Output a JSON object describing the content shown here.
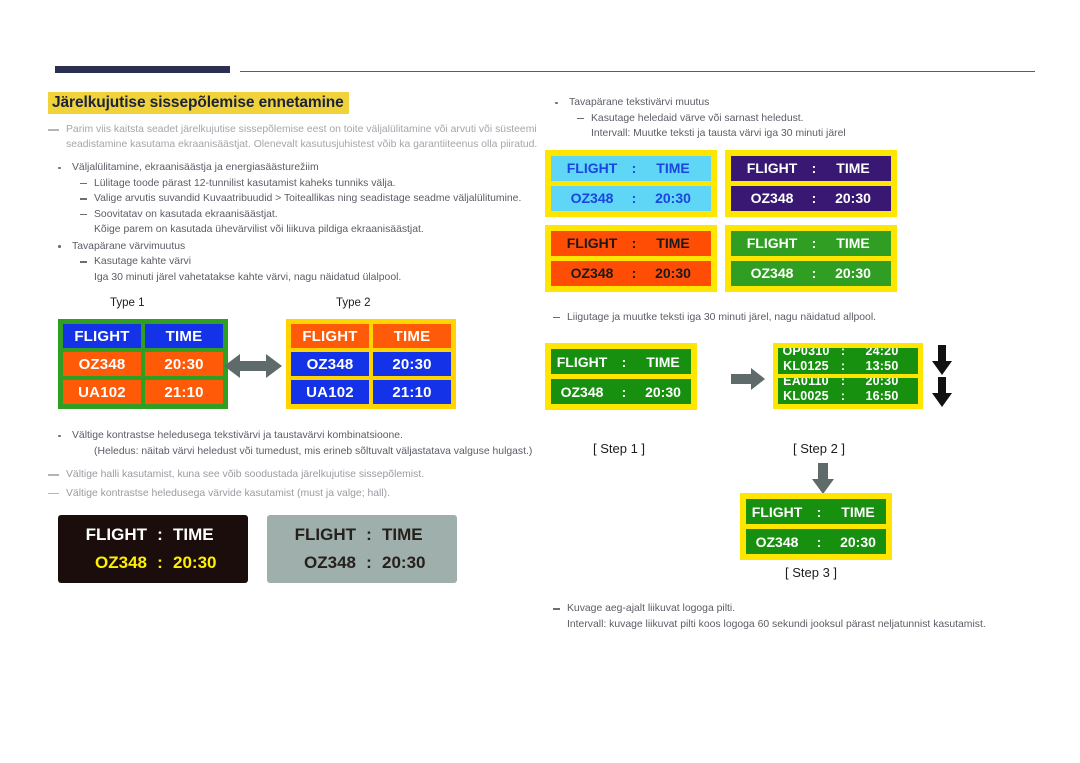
{
  "header": {
    "bar_color": "#2b3050",
    "rule_color": "#5b5b70"
  },
  "left": {
    "title": "Järelkujutise sissepõlemise ennetamine",
    "title_highlight": "#f0d33a",
    "note_intro": "Parim viis kaitsta seadet järelkujutise sissepõlemise eest on toite väljalülitamine või arvuti või süsteemi seadistamine kasutama ekraanisäästjat. Olenevalt kasutusjuhistest võib ka garantiiteenus olla piiratud.",
    "bullet1": "Väljalülitamine, ekraanisäästja ja energiasäästurežiim",
    "bullet1_sub": [
      "Lülitage toode pärast 12-tunnilist kasutamist kaheks tunniks välja.",
      "Valige arvutis suvandid Kuvaatribuudid > Toiteallikas ning seadistage seadme väljalülitumine.",
      "Soovitatav on kasutada ekraanisäästjat."
    ],
    "bullet1_note": "Kõige parem on kasutada ühevärvilist või liikuva pildiga ekraanisäästjat.",
    "bullet2": "Tavapärane värvimuutus",
    "bullet2_sub": "Kasutage kahte värvi",
    "bullet2_note": "Iga 30 minuti järel vahetatakse kahte värvi, nagu näidatud ülalpool.",
    "type1_label": "Type 1",
    "type2_label": "Type 2",
    "board_type1": {
      "border_color": "#2f9e23",
      "header_bg": "#1433e8",
      "data_bg": "#ff5a08",
      "rows": [
        [
          "FLIGHT",
          "TIME"
        ],
        [
          "OZ348",
          "20:30"
        ],
        [
          "UA102",
          "21:10"
        ]
      ]
    },
    "board_type2": {
      "border_color": "#ffd400",
      "header_bg": "#ff5a08",
      "data_bg": "#1433e8",
      "rows": [
        [
          "FLIGHT",
          "TIME"
        ],
        [
          "OZ348",
          "20:30"
        ],
        [
          "UA102",
          "21:10"
        ]
      ]
    },
    "bullet3": "Vältige kontrastse heledusega tekstivärvi ja taustavärvi kombinatsioone.",
    "bullet3_note": "(Heledus: näitab värvi heledust või tumedust, mis erineb sõltuvalt väljastatava valguse hulgast.)",
    "note2": "Vältige halli kasutamist, kuna see võib soodustada järelkujutise sissepõlemist.",
    "note3": "Vältige kontrastse heledusega värvide kasutamist (must ja valge; hall).",
    "sample_dark": {
      "bg": "#1a0d0b",
      "line1": [
        "FLIGHT",
        ":",
        "TIME"
      ],
      "line2": [
        "OZ348",
        ":",
        "20:30"
      ],
      "line1_color": "#ffffff",
      "line2_color": "#ffef00"
    },
    "sample_gray": {
      "bg": "#9fb0ac",
      "line1": [
        "FLIGHT",
        ":",
        "TIME"
      ],
      "line2": [
        "OZ348",
        ":",
        "20:30"
      ],
      "text_color": "#26201c"
    }
  },
  "right": {
    "bullet1": "Tavapärane tekstivärvi muutus",
    "bullet1_sub": "Kasutage heledaid värve või sarnast heledust.",
    "bullet1_note": "Intervall: Muutke teksti ja tausta värvi iga 30 minuti järel",
    "panels": [
      {
        "name": "cyan",
        "frame": "#ffe600",
        "bg": "#5fd6f5",
        "fg": "#1a45e0",
        "line1": [
          "FLIGHT",
          ":",
          "TIME"
        ],
        "line2": [
          "OZ348",
          ":",
          "20:30"
        ]
      },
      {
        "name": "purple",
        "frame": "#ffe600",
        "bg": "#381872",
        "fg": "#ffffff",
        "line1": [
          "FLIGHT",
          ":",
          "TIME"
        ],
        "line2": [
          "OZ348",
          ":",
          "20:30"
        ]
      },
      {
        "name": "orange",
        "frame": "#ffe600",
        "bg": "#ff4d06",
        "fg": "#1a1a1a",
        "line1": [
          "FLIGHT",
          ":",
          "TIME"
        ],
        "line2": [
          "OZ348",
          ":",
          "20:30"
        ]
      },
      {
        "name": "green",
        "frame": "#ffe600",
        "bg": "#2f9e23",
        "fg": "#ffffff",
        "line1": [
          "FLIGHT",
          ":",
          "TIME"
        ],
        "line2": [
          "OZ348",
          ":",
          "20:30"
        ]
      }
    ],
    "bullet2_sub": "Liigutage ja muutke teksti iga 30 minuti järel, nagu näidatud allpool.",
    "step1_board": {
      "frame": "#ffe600",
      "bg": "#17900f",
      "fg": "#ffffff",
      "line1": [
        "FLIGHT",
        ":",
        "TIME"
      ],
      "line2": [
        "OZ348",
        ":",
        "20:30"
      ]
    },
    "step2_board": {
      "frame": "#ffe600",
      "bg": "#17900f",
      "fg": "#ffffff",
      "slot1": [
        [
          "OP0310",
          ":",
          "24:20"
        ],
        [
          "KL0125",
          ":",
          "13:50"
        ]
      ],
      "slot2": [
        [
          "EA0110",
          ":",
          "20:30"
        ],
        [
          "KL0025",
          ":",
          "16:50"
        ]
      ]
    },
    "step3_board": {
      "frame": "#ffe600",
      "bg": "#17900f",
      "fg": "#ffffff",
      "line1": [
        "FLIGHT",
        ":",
        "TIME"
      ],
      "line2": [
        "OZ348",
        ":",
        "20:30"
      ]
    },
    "step1_label": "[ Step 1 ]",
    "step2_label": "[ Step 2 ]",
    "step3_label": "[ Step 3 ]",
    "bullet3_sub": "Kuvage aeg-ajalt liikuvat logoga pilti.",
    "bullet3_note": "Intervall: kuvage liikuvat pilti koos logoga 60 sekundi jooksul pärast neljatunnist kasutamist."
  }
}
